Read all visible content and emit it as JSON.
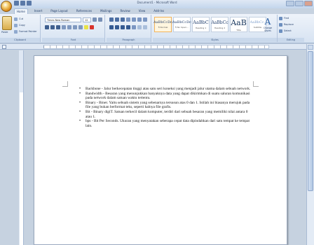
{
  "window": {
    "title": "Document1 - Microsoft Word"
  },
  "tabs": [
    "Home",
    "Insert",
    "Page Layout",
    "References",
    "Mailings",
    "Review",
    "View",
    "Add-Ins"
  ],
  "ribbon": {
    "clipboard": {
      "paste_label": "Paste",
      "cut_label": "Cut",
      "copy_label": "Copy",
      "format_painter_label": "Format Painter",
      "group_label": "Clipboard"
    },
    "font": {
      "font_name": "Times New Roman",
      "font_size": "12",
      "group_label": "Font"
    },
    "paragraph": {
      "group_label": "Paragraph"
    },
    "styles": {
      "items": [
        {
          "sample": "AaBbCcDc",
          "name": "¶ Normal"
        },
        {
          "sample": "AaBbCcDc",
          "name": "¶ No Spaci..."
        },
        {
          "sample": "AaBbC",
          "name": "Heading 1"
        },
        {
          "sample": "AaBbCc",
          "name": "Heading 2"
        },
        {
          "sample": "AaB",
          "name": "Title"
        },
        {
          "sample": "AaBbCc.",
          "name": "Subtitle"
        }
      ],
      "change_styles_label": "Change Styles",
      "group_label": "Styles"
    },
    "editing": {
      "find_label": "Find",
      "replace_label": "Replace",
      "select_label": "Select",
      "group_label": "Editing"
    }
  },
  "document": {
    "bullets": [
      "Backbone - Jalur berkecepatan tinggi atau satu seri koneksi yang menjadi jalur utama dalam sebuah network.",
      "Bandwidth - Besaran yang menunjukkan banyaknya data yang dapat dikirimkan di suatu saluran komunikasi pada network dalam satuan waktu tertentu.",
      "Binary - Biner. Yaitu sebuah sistem yang sebenarnya tersusun atas 0 dan 1. Istilah ini biasanya merujuk pada file yang bukan berformat teks, seperti halnya file grafis.",
      "Bit - Binary digiT. Satuan terkecil dalam komputer, terdiri dari sebuah besaran yang memiliki nilai antara 0 atau 1.",
      "bps - Bit Per Seconds. Ukuran yang menyatakan seberapa cepat data dipindahkan dari satu tempat ke tempat lain."
    ]
  }
}
